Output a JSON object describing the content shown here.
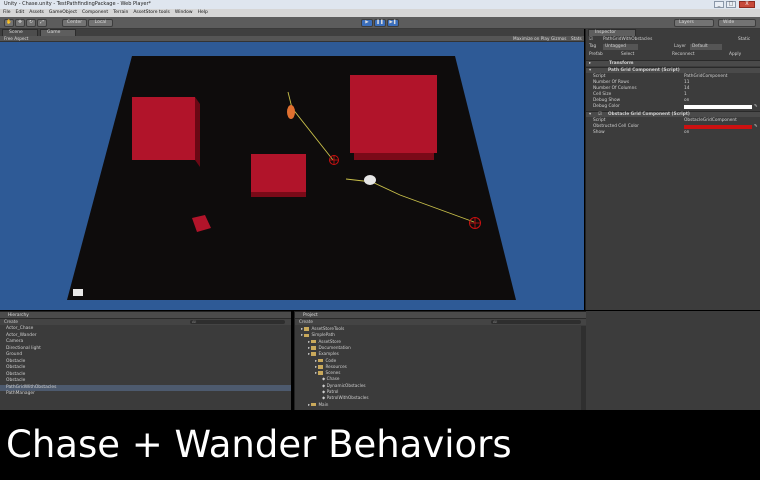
{
  "window": {
    "title": "Unity - Chase.unity - TestPathfindingPackage - Web Player*",
    "min_label": "_",
    "max_label": "□",
    "close_label": "X"
  },
  "menu": [
    "File",
    "Edit",
    "Assets",
    "GameObject",
    "Component",
    "Terrain",
    "AssetStore tools",
    "Window",
    "Help"
  ],
  "toolbar": {
    "center_label": "Center",
    "local_label": "Local",
    "layers_label": "Layers",
    "layout_label": "Wide"
  },
  "scene": {
    "tabs": [
      "Scene",
      "Game"
    ],
    "aspect": "Free Aspect",
    "maximize_on_play": "Maximize on Play",
    "gizmos": "Gizmos",
    "stats": "Stats"
  },
  "inspector": {
    "tab": "Inspector",
    "object_name": "PathGridWithObstacles",
    "static_label": "Static",
    "tag_label": "Tag",
    "tag_value": "Untagged",
    "layer_label": "Layer",
    "layer_value": "Default",
    "prefab_label": "Prefab",
    "select_label": "Select",
    "reconnect_label": "Reconnect",
    "apply_label": "Apply",
    "transform_label": "Transform",
    "comp1_title": "Path Grid Component (Script)",
    "comp1_fields": [
      {
        "label": "Script",
        "value": "PathGridComponent"
      },
      {
        "label": "Number Of Rows",
        "value": "11"
      },
      {
        "label": "Number Of Columns",
        "value": "14"
      },
      {
        "label": "Cell Size",
        "value": "1"
      },
      {
        "label": "Debug Show",
        "value": "on"
      },
      {
        "label": "Debug Color",
        "value": ""
      }
    ],
    "comp2_title": "Obstacle Grid Component (Script)",
    "comp2_fields": [
      {
        "label": "Script",
        "value": "ObstacleGridComponent"
      },
      {
        "label": "Obstructed Cell Color",
        "value": ""
      },
      {
        "label": "Show",
        "value": "on"
      }
    ],
    "debug_color": "#ffffff",
    "obstructed_color": "#cc1111"
  },
  "hierarchy": {
    "tab": "Hierarchy",
    "create_label": "Create",
    "search_placeholder": "All",
    "items": [
      "Actor_Chase",
      "Actor_Wander",
      "Camera",
      "Directional light",
      "Ground",
      "Obstacle",
      "Obstacle",
      "Obstacle",
      "Obstacle",
      "PathGridWithObstacles",
      "PathManager"
    ],
    "selected_index": 9
  },
  "project": {
    "tab": "Project",
    "create_label": "Create",
    "search_placeholder": "All",
    "items": [
      {
        "label": "AssetStoreTools",
        "indent": 0,
        "type": "folder"
      },
      {
        "label": "SimplePath",
        "indent": 0,
        "type": "folder"
      },
      {
        "label": "AssetStore",
        "indent": 1,
        "type": "folder"
      },
      {
        "label": "Documentation",
        "indent": 1,
        "type": "folder"
      },
      {
        "label": "Examples",
        "indent": 1,
        "type": "folder"
      },
      {
        "label": "Code",
        "indent": 2,
        "type": "folder"
      },
      {
        "label": "Resources",
        "indent": 2,
        "type": "folder"
      },
      {
        "label": "Scenes",
        "indent": 2,
        "type": "folder"
      },
      {
        "label": "Chase",
        "indent": 3,
        "type": "scene"
      },
      {
        "label": "DynamicObstacles",
        "indent": 3,
        "type": "scene"
      },
      {
        "label": "Patrol",
        "indent": 3,
        "type": "scene"
      },
      {
        "label": "PatrolWithObstacles",
        "indent": 3,
        "type": "scene"
      },
      {
        "label": "Main",
        "indent": 1,
        "type": "folder"
      }
    ]
  },
  "caption": "Chase + Wander Behaviors",
  "colors": {
    "viewport_bg": "#2e5a96",
    "ground": "#0e0c0c",
    "obstacle": "#b1142a",
    "path_line": "#c9c04a",
    "target_marker": "#cc1111"
  }
}
